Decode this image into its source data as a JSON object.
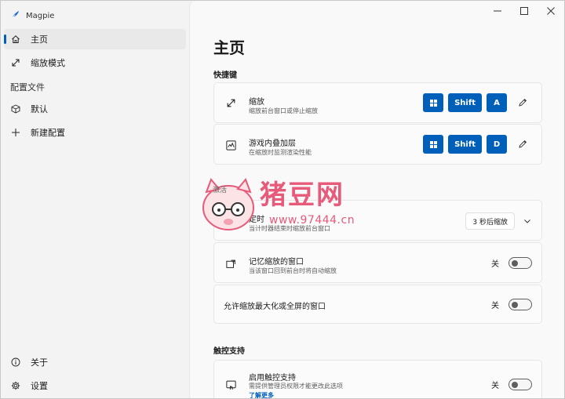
{
  "app": {
    "title": "Magpie"
  },
  "titlebar": {
    "minimize": "—",
    "maximize": "☐",
    "close": "✕"
  },
  "sidebar": {
    "items": [
      {
        "label": "主页",
        "icon": "home-icon",
        "active": true
      },
      {
        "label": "缩放模式",
        "icon": "expand-icon"
      }
    ],
    "profiles_label": "配置文件",
    "profiles": [
      {
        "label": "默认",
        "icon": "cube-icon"
      },
      {
        "label": "新建配置",
        "icon": "plus-icon"
      }
    ],
    "footer": [
      {
        "label": "关于",
        "icon": "info-icon"
      },
      {
        "label": "设置",
        "icon": "gear-icon"
      }
    ]
  },
  "main": {
    "title": "主页",
    "shortcuts": {
      "heading": "快捷键",
      "items": [
        {
          "title": "缩放",
          "desc": "缩放前台窗口或停止缩放",
          "keys": [
            "⊞",
            "Shift",
            "A"
          ]
        },
        {
          "title": "游戏内叠加层",
          "desc": "在缩放时监测渲染性能",
          "keys": [
            "⊞",
            "Shift",
            "D"
          ]
        }
      ]
    },
    "timer": {
      "title": "定时",
      "desc": "当计时器结束时缩放前台窗口",
      "dropdown_value": "3 秒后缩放"
    },
    "remember": {
      "title": "记忆缩放的窗口",
      "desc": "当该窗口回到前台时将自动缩放",
      "toggle_label": "关"
    },
    "allow_max": {
      "title": "允许缩放最大化或全屏的窗口",
      "toggle_label": "关"
    },
    "touch": {
      "heading": "触控支持",
      "title": "启用触控支持",
      "desc": "需提供管理员权限才能更改此选项",
      "link": "了解更多",
      "toggle_label": "关"
    }
  },
  "watermark": {
    "text": "猪豆网",
    "url": "www.97444.cn",
    "badge": "激活"
  },
  "colors": {
    "accent": "#005fb8",
    "watermark": "#e85a7a"
  }
}
